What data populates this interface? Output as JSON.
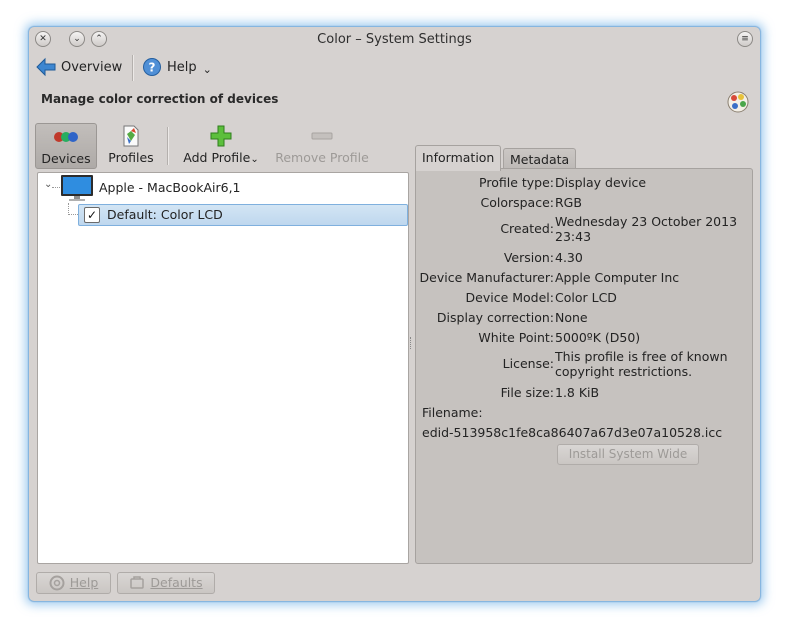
{
  "window": {
    "title": "Color – System Settings"
  },
  "toolbar": {
    "overview_label": "Overview",
    "help_label": "Help",
    "help_menu_arrow": "⌄"
  },
  "page": {
    "heading": "Manage color correction of devices"
  },
  "actions": {
    "devices_label": "Devices",
    "profiles_label": "Profiles",
    "add_profile_label": "Add Profile",
    "add_profile_arrow": "⌄",
    "remove_profile_label": "Remove Profile"
  },
  "tree": {
    "device_name": "Apple - MacBookAir6,1",
    "profile_name": "Default: Color LCD",
    "profile_checked": true
  },
  "tabs": {
    "information": "Information",
    "metadata": "Metadata"
  },
  "info": {
    "rows": [
      {
        "label": "Profile type:",
        "value": "Display device"
      },
      {
        "label": "Colorspace:",
        "value": "RGB"
      },
      {
        "label": "Created:",
        "value": "Wednesday 23 October 2013\n23:43"
      },
      {
        "label": "Version:",
        "value": "4.30"
      },
      {
        "label": "Device Manufacturer:",
        "value": "Apple Computer Inc"
      },
      {
        "label": "Device Model:",
        "value": "Color LCD"
      },
      {
        "label": "Display correction:",
        "value": "None"
      },
      {
        "label": "White Point:",
        "value": "5000ºK (D50)"
      },
      {
        "label": "License:",
        "value": "This profile is free of known\ncopyright restrictions."
      },
      {
        "label": "File size:",
        "value": "1.8 KiB"
      }
    ],
    "filename_label": "Filename:",
    "filename_value": "edid-513958c1fe8ca86407a67d3e07a10528.icc",
    "install_button": "Install System Wide"
  },
  "footer": {
    "help_button": "Help",
    "defaults_button": "Defaults"
  },
  "colors": {
    "window_bg": "#d6d2d0",
    "panel_bg": "#c6c2bf",
    "selection_bg": "#c9dff2",
    "selection_border": "#7fb0de",
    "window_glow": "#70b0e6"
  }
}
